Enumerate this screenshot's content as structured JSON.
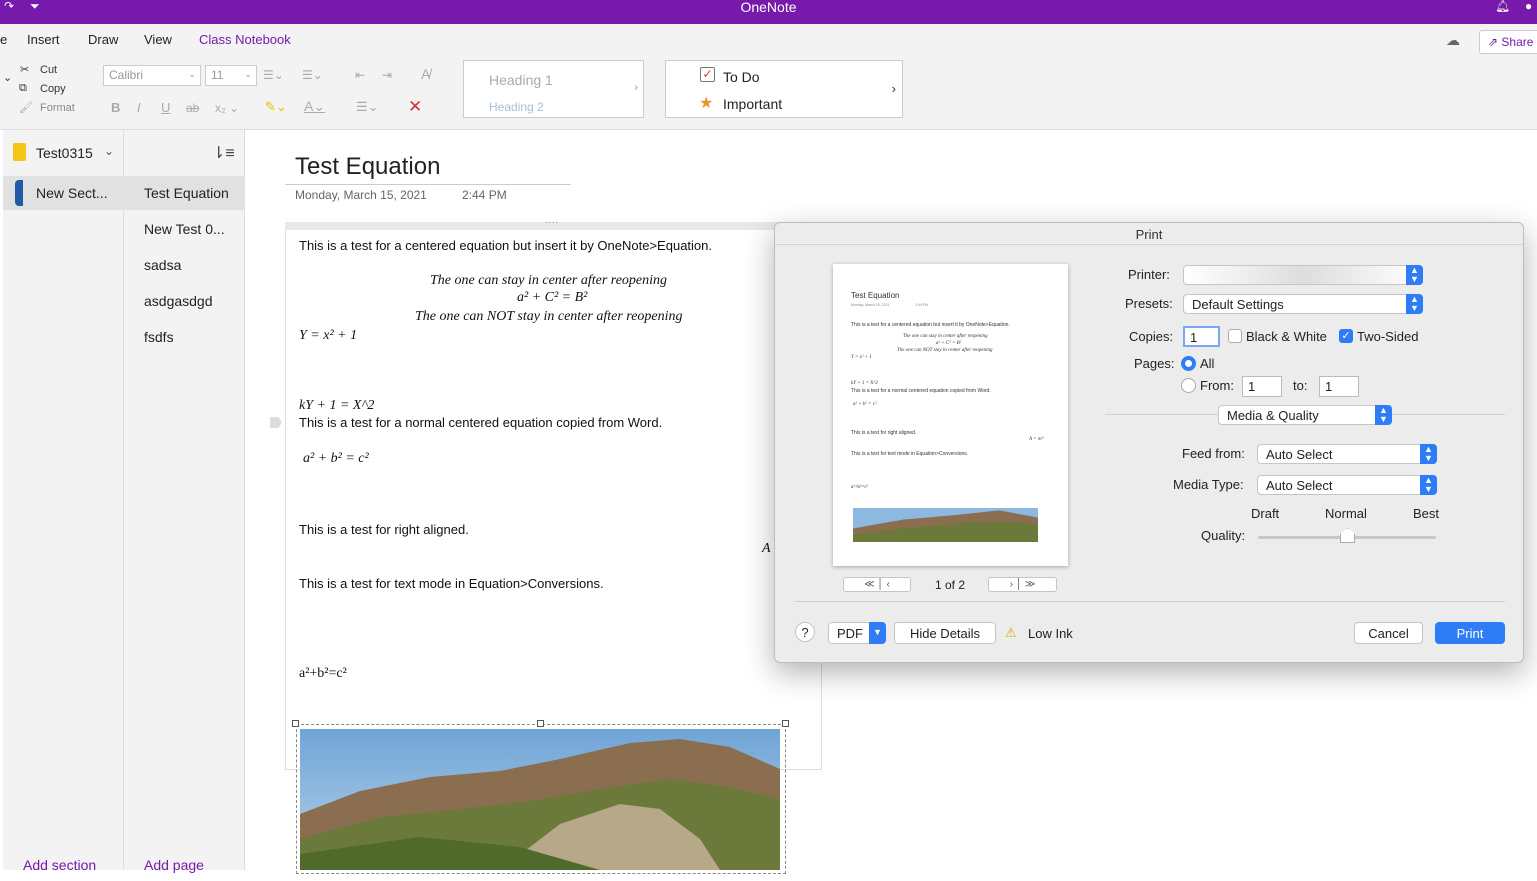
{
  "app": {
    "title": "OneNote"
  },
  "menu": {
    "tabs": [
      "e",
      "Insert",
      "Draw",
      "View",
      "Class Notebook"
    ],
    "share": "Share"
  },
  "ribbon": {
    "cut": "Cut",
    "copy": "Copy",
    "format": "Format",
    "font": "Calibri",
    "size": "11",
    "bold": "B",
    "italic": "I",
    "underline": "U",
    "strike": "ab",
    "subscript": "x",
    "heading1": "Heading 1",
    "heading2": "Heading 2",
    "todo": "To Do",
    "important": "Important"
  },
  "notebook": {
    "name": "Test0315",
    "section": "New Sect..."
  },
  "pages": [
    "Test Equation",
    "New Test 0...",
    "sadsa",
    "asdgasdgd",
    "fsdfs"
  ],
  "footer": {
    "add_section": "Add section",
    "add_page": "Add page"
  },
  "note": {
    "title": "Test Equation",
    "date": "Monday, March 15, 2021",
    "time": "2:44 PM",
    "line1": "This is a test for a centered equation but insert it by OneNote>Equation.",
    "center1": "The one can stay in center after reopening",
    "eq1": "a² + C² = B²",
    "center2": "The one can NOT stay in center after reopening",
    "eq2": "Y = x² + 1",
    "eq3": "kY + 1 = X^2",
    "line2": "This is a test for a normal centered equation copied from Word.",
    "eq4": "a² + b² = c²",
    "line3": "This is a test for right aligned.",
    "eq5": "A",
    "line4": "This is a test for text mode in Equation>Conversions.",
    "eq6": "a²+b²=c²"
  },
  "print": {
    "title": "Print",
    "printer_label": "Printer:",
    "presets_label": "Presets:",
    "presets_value": "Default Settings",
    "copies_label": "Copies:",
    "copies_value": "1",
    "bw_label": "Black & White",
    "twosided_label": "Two-Sided",
    "bw_checked": false,
    "twosided_checked": true,
    "pages_label": "Pages:",
    "all_label": "All",
    "from_label": "From:",
    "from_value": "1",
    "to_label": "to:",
    "to_value": "1",
    "section_value": "Media & Quality",
    "feed_label": "Feed from:",
    "feed_value": "Auto Select",
    "media_label": "Media Type:",
    "media_value": "Auto Select",
    "quality_label": "Quality:",
    "q_draft": "Draft",
    "q_normal": "Normal",
    "q_best": "Best",
    "quality_level": 0.5,
    "page_indicator": "1 of 2",
    "help": "?",
    "pdf": "PDF",
    "hide_details": "Hide Details",
    "low_ink": "Low Ink",
    "cancel": "Cancel",
    "print": "Print",
    "preview": {
      "title": "Test Equation",
      "date": "Monday, March 15, 2021",
      "time": "2:44 PM",
      "l1": "This is a test for a centered equation but insert it by OneNote>Equation.",
      "c1": "The one can stay in center after reopening",
      "e1": "a² + C² = B²",
      "c2": "The one can NOT stay in center after reopening",
      "e2": "Y = x² + 1",
      "e3": "kY + 1 = X^2",
      "l2": "This is a test for a normal centered equation copied from Word.",
      "e4": "a² + b² = c²",
      "l3": "This is a test for right aligned.",
      "e5": "A = πr²",
      "l4": "This is a test for text mode in Equation>Conversions.",
      "e6": "a²+b²=c²"
    }
  },
  "colors": {
    "brand": "#7719aa",
    "accent": "#2f7df6",
    "section": "#1e5aa6"
  },
  "icons": [
    "redo-icon",
    "quick-access-icon",
    "bell-icon",
    "account-icon",
    "sync-icon",
    "share-icon",
    "cut-icon",
    "copy-icon",
    "format-painter-icon",
    "notebook-icon",
    "sort-icon",
    "checkbox-icon",
    "star-icon",
    "warning-icon",
    "ink-icon"
  ]
}
